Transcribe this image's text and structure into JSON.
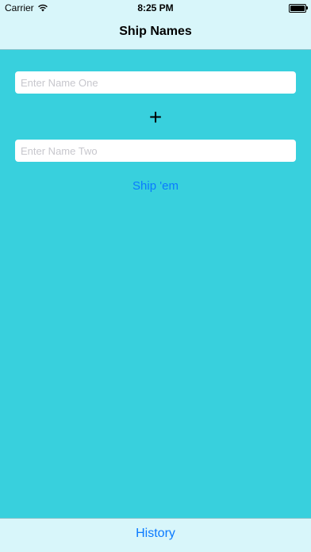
{
  "status_bar": {
    "carrier": "Carrier",
    "time": "8:25 PM"
  },
  "nav": {
    "title": "Ship Names"
  },
  "form": {
    "name_one_placeholder": "Enter Name One",
    "name_one_value": "",
    "plus_symbol": "+",
    "name_two_placeholder": "Enter Name Two",
    "name_two_value": "",
    "ship_button_label": "Ship 'em"
  },
  "toolbar": {
    "history_label": "History"
  },
  "colors": {
    "background": "#38d0dd",
    "bar_background": "#d8f6fa",
    "accent": "#0a7aff"
  }
}
